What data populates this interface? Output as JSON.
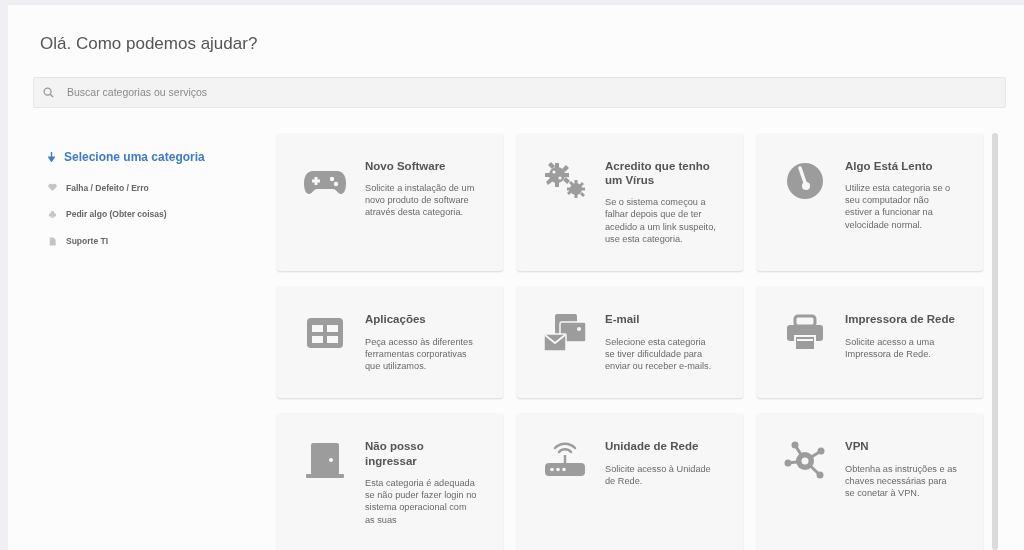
{
  "title": "Olá. Como podemos ajudar?",
  "search": {
    "placeholder": "Buscar categorias ou serviços"
  },
  "sidebar": {
    "heading": "Selecione uma categoria",
    "items": [
      {
        "label": "Falha / Defeito / Erro"
      },
      {
        "label": "Pedir algo (Obter coisas)"
      },
      {
        "label": "Suporte TI"
      }
    ]
  },
  "cards": [
    {
      "title": "Novo Software",
      "description": "Solicite a instalação de um novo produto de software através desta categoria."
    },
    {
      "title": "Acredito que tenho um Vírus",
      "description": "Se o sistema começou a falhar depois que de ter acedido a um link suspeito, use esta categoria."
    },
    {
      "title": "Algo Está Lento",
      "description": "Utilize esta categoria se o seu computador não estiver a funcionar na velocidade normal."
    },
    {
      "title": "Aplicações",
      "description": "Peça acesso às diferentes ferramentas corporativas que utilizamos."
    },
    {
      "title": "E-mail",
      "description": "Selecione esta categoria se tiver dificuldade para enviar ou receber e-mails."
    },
    {
      "title": "Impressora de Rede",
      "description": "Solicite acesso a uma Impressora de Rede."
    },
    {
      "title": "Não posso ingressar",
      "description": "Esta categoria é adequada se não puder fazer login no sistema operacional com as suas"
    },
    {
      "title": "Unidade de Rede",
      "description": "Solicite acesso à Unidade de Rede."
    },
    {
      "title": "VPN",
      "description": "Obtenha as instruções e as chaves necessárias para se conetar à VPN."
    }
  ]
}
